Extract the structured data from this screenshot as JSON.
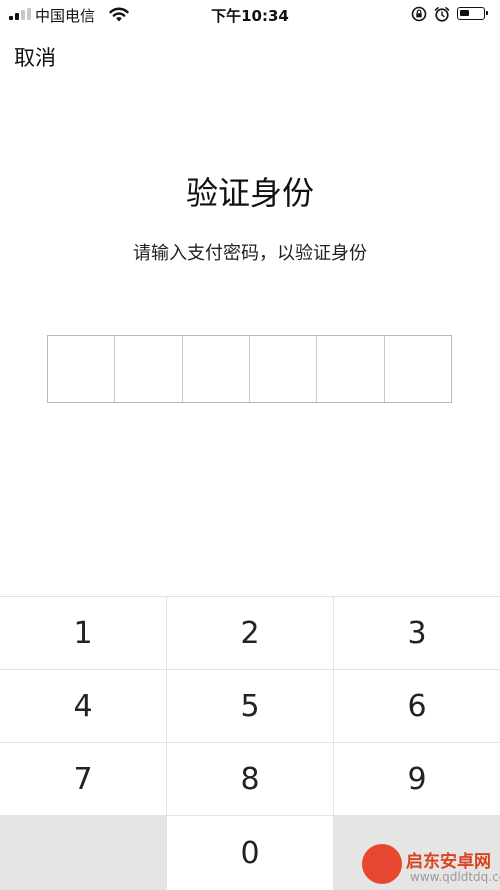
{
  "status_bar": {
    "carrier": "中国电信",
    "time": "下午10:34",
    "battery_level": 0.45
  },
  "nav": {
    "cancel_label": "取消"
  },
  "main": {
    "title": "验证身份",
    "subtitle": "请输入支付密码，以验证身份",
    "pin_length": 6
  },
  "keypad": {
    "rows": [
      [
        "1",
        "2",
        "3"
      ],
      [
        "4",
        "5",
        "6"
      ],
      [
        "7",
        "8",
        "9"
      ],
      [
        "",
        "0",
        ""
      ]
    ]
  },
  "watermark": {
    "name": "启东安卓网",
    "url": "www.qdldtdq.com"
  }
}
